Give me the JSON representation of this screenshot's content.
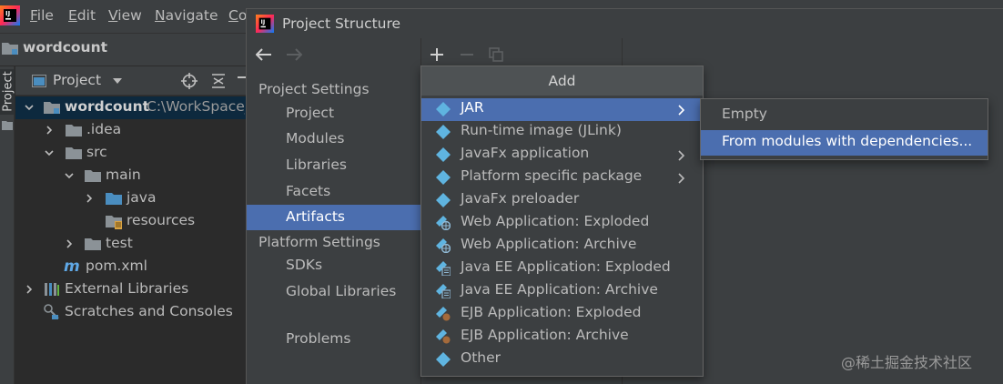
{
  "menubar": {
    "items": [
      {
        "mnemonic": "F",
        "rest": "ile"
      },
      {
        "mnemonic": "E",
        "rest": "dit"
      },
      {
        "mnemonic": "V",
        "rest": "iew"
      },
      {
        "mnemonic": "N",
        "rest": "avigate"
      },
      {
        "mnemonic": "C",
        "rest": "o"
      }
    ]
  },
  "navbar": {
    "project_name": "wordcount"
  },
  "left_stripe": {
    "label": "Project"
  },
  "project_panel": {
    "view_label": "Project",
    "tree": [
      {
        "label": "wordcount",
        "path": "C:\\WorkSpace_"
      },
      {
        "label": ".idea"
      },
      {
        "label": "src"
      },
      {
        "label": "main"
      },
      {
        "label": "java"
      },
      {
        "label": "resources"
      },
      {
        "label": "test"
      },
      {
        "label": "pom.xml"
      },
      {
        "label": "External Libraries"
      },
      {
        "label": "Scratches and Consoles"
      }
    ]
  },
  "dialog": {
    "title": "Project Structure",
    "sections": {
      "project_settings": "Project Settings",
      "platform_settings": "Platform Settings"
    },
    "project_settings_items": [
      "Project",
      "Modules",
      "Libraries",
      "Facets",
      "Artifacts"
    ],
    "selected_item": "Artifacts",
    "platform_settings_items": [
      "SDKs",
      "Global Libraries"
    ],
    "problems": "Problems"
  },
  "add_popup": {
    "title": "Add",
    "items": [
      {
        "label": "JAR",
        "submenu": true
      },
      {
        "label": "Run-time image (JLink)",
        "submenu": false
      },
      {
        "label": "JavaFx application",
        "submenu": true
      },
      {
        "label": "Platform specific package",
        "submenu": true
      },
      {
        "label": "JavaFx preloader",
        "submenu": false
      },
      {
        "label": "Web Application: Exploded",
        "submenu": false
      },
      {
        "label": "Web Application: Archive",
        "submenu": false
      },
      {
        "label": "Java EE Application: Exploded",
        "submenu": false
      },
      {
        "label": "Java EE Application: Archive",
        "submenu": false
      },
      {
        "label": "EJB Application: Exploded",
        "submenu": false
      },
      {
        "label": "EJB Application: Archive",
        "submenu": false
      },
      {
        "label": "Other",
        "submenu": false
      }
    ],
    "selected": "JAR"
  },
  "jar_submenu": {
    "items": [
      "Empty",
      "From modules with dependencies..."
    ],
    "selected": "From modules with dependencies..."
  },
  "watermark": "@稀土掘金技术社区",
  "colors": {
    "selection": "#4b6eaf",
    "artifact_icon": "#5fb4e0",
    "folder": "#8b9297",
    "source_folder": "#4a8dbf"
  },
  "icons": {
    "artifact": "artifact-diamond-icon",
    "folder": "folder-icon",
    "maven": "maven-m-icon"
  }
}
